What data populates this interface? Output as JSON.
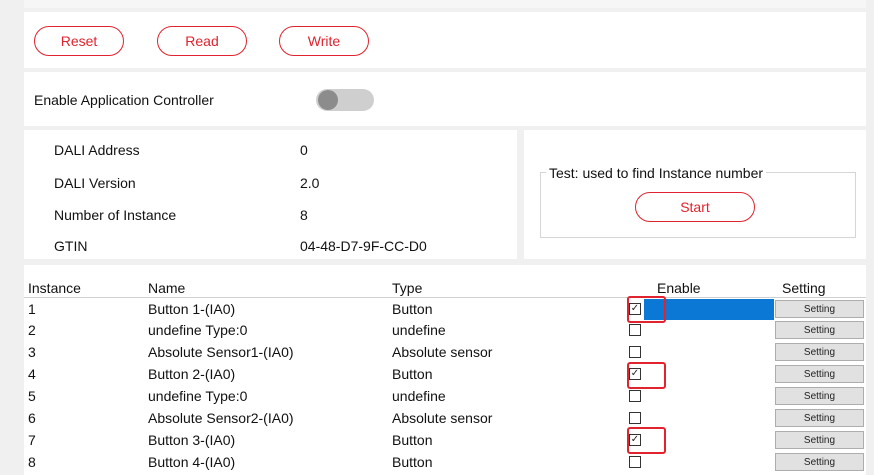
{
  "toolbar": {
    "reset": "Reset",
    "read": "Read",
    "write": "Write"
  },
  "app_controller": {
    "label": "Enable Application Controller",
    "enabled": false
  },
  "info": {
    "rows": [
      {
        "label": "DALI Address",
        "value": "0"
      },
      {
        "label": "DALI Version",
        "value": "2.0"
      },
      {
        "label": "Number of Instance",
        "value": "8"
      },
      {
        "label": "GTIN",
        "value": "04-48-D7-9F-CC-D0"
      }
    ]
  },
  "test": {
    "legend": "Test: used to find Instance number",
    "start": "Start"
  },
  "table": {
    "headers": {
      "instance": "Instance",
      "name": "Name",
      "type": "Type",
      "enable": "Enable",
      "setting": "Setting"
    },
    "rows": [
      {
        "instance": "1",
        "name": "Button 1-(IA0)",
        "type": "Button",
        "enabled": true,
        "setting": "Setting"
      },
      {
        "instance": "2",
        "name": "undefine Type:0",
        "type": "undefine",
        "enabled": false,
        "setting": "Setting"
      },
      {
        "instance": "3",
        "name": "Absolute Sensor1-(IA0)",
        "type": "Absolute sensor",
        "enabled": false,
        "setting": "Setting"
      },
      {
        "instance": "4",
        "name": "Button 2-(IA0)",
        "type": "Button",
        "enabled": true,
        "setting": "Setting"
      },
      {
        "instance": "5",
        "name": "undefine Type:0",
        "type": "undefine",
        "enabled": false,
        "setting": "Setting"
      },
      {
        "instance": "6",
        "name": "Absolute Sensor2-(IA0)",
        "type": "Absolute sensor",
        "enabled": false,
        "setting": "Setting"
      },
      {
        "instance": "7",
        "name": "Button 3-(IA0)",
        "type": "Button",
        "enabled": true,
        "setting": "Setting"
      },
      {
        "instance": "8",
        "name": "Button 4-(IA0)",
        "type": "Button",
        "enabled": false,
        "setting": "Setting"
      }
    ]
  },
  "colors": {
    "accent": "#e0232e",
    "selection": "#0c78d6"
  }
}
